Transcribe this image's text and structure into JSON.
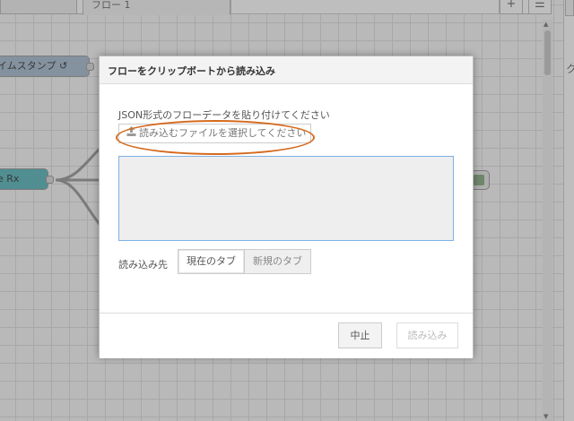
{
  "tabs": {
    "active_label": "フロー 1",
    "add_icon": "plus-icon",
    "menu_icon": "list-icon"
  },
  "nodes": [
    {
      "label": "イムスタンプ ↺",
      "color": "#a6bbcf"
    },
    {
      "label": "e Rx",
      "color": "#57b5ba"
    }
  ],
  "sidebar": {
    "partial_char": "ク"
  },
  "dialog": {
    "title": "フローをクリップボートから読み込み",
    "json_label": "JSON形式のフローデータを貼り付けてください",
    "upload_label": "読み込むファイルを選択してください",
    "upload_icon": "upload-icon",
    "textarea_value": "",
    "dest_label": "読み込み先",
    "dest_options": [
      "現在のタブ",
      "新規のタブ"
    ],
    "dest_selected": "現在のタブ",
    "cancel_label": "中止",
    "import_label": "読み込み",
    "highlight_color": "#d56a1e"
  }
}
